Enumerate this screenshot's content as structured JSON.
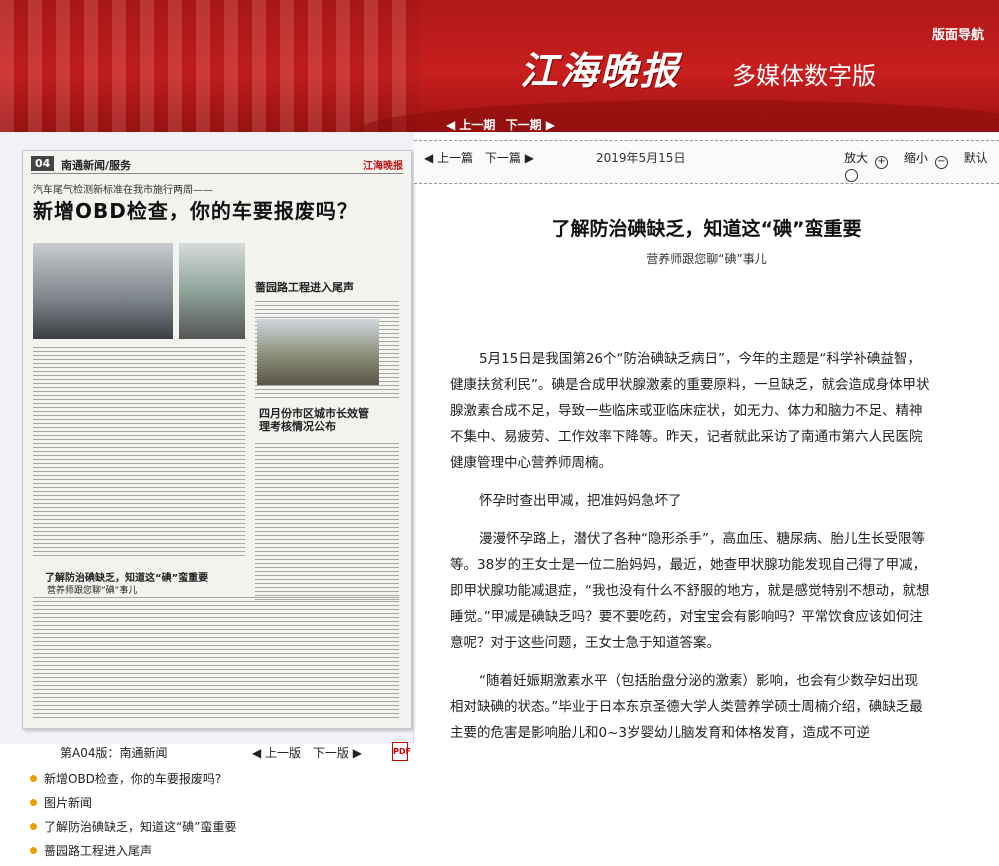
{
  "header": {
    "nav_link": "版面导航",
    "logo_text": "江海晚报",
    "logo_subtitle": "多媒体数字版",
    "prev_issue": "◀ 上一期",
    "next_issue": "下一期 ▶"
  },
  "newspaper": {
    "page_no": "04",
    "section": "南通新闻/服务",
    "brand": "江海晚报",
    "kicker": "汽车尾气检测新标准在我市施行两周——",
    "headline": "新增OBD检查，你的车要报废吗？",
    "sub1": "蔷园路工程进入尾声",
    "sub2": "四月份市区城市长效管理考核情况公布",
    "sub3": "了解防治碘缺乏，知道这“碘”蛮重要",
    "sub3b": "营养师跟您聊“碘”事儿"
  },
  "page_info": {
    "page_label": "第A04版：南通新闻",
    "prev_page": "◀ 上一版",
    "next_page": "下一版 ▶",
    "pdf_icon": "pdf-icon"
  },
  "article_list": [
    "新增OBD检查，你的车要报废吗?",
    "图片新闻",
    "了解防治碘缺乏，知道这“碘”蛮重要",
    "蔷园路工程进入尾声"
  ],
  "toolbar": {
    "prev_article": "◀ 上一篇",
    "next_article": "下一篇 ▶",
    "date": "2019年5月15日",
    "zoom_in": "放大",
    "zoom_out": "缩小",
    "default": "默认"
  },
  "article": {
    "title": "了解防治碘缺乏，知道这“碘”蛮重要",
    "subtitle": "营养师跟您聊“碘”事儿",
    "paragraphs": [
      "5月15日是我国第26个“防治碘缺乏病日”，今年的主题是“科学补碘益智，健康扶贫利民”。碘是合成甲状腺激素的重要原料，一旦缺乏，就会造成身体甲状腺激素合成不足，导致一些临床或亚临床症状，如无力、体力和脑力不足、精神不集中、易疲劳、工作效率下降等。昨天，记者就此采访了南通市第六人民医院健康管理中心营养师周楠。",
      "怀孕时查出甲减，把准妈妈急坏了",
      "漫漫怀孕路上，潜伏了各种“隐形杀手”，高血压、糖尿病、胎儿生长受限等等。38岁的王女士是一位二胎妈妈，最近，她查甲状腺功能发现自己得了甲减，即甲状腺功能减退症，“我也没有什么不舒服的地方，就是感觉特别不想动，就想睡觉。”甲减是碘缺乏吗？要不要吃药，对宝宝会有影响吗？平常饮食应该如何注意呢？对于这些问题，王女士急于知道答案。",
      "“随着妊娠期激素水平（包括胎盘分泌的激素）影响，也会有少数孕妇出现相对缺碘的状态。”毕业于日本东京圣德大学人类营养学硕士周楠介绍，碘缺乏最主要的危害是影响胎儿和0~3岁婴幼儿脑发育和体格发育，造成不可逆"
    ]
  },
  "colors": {
    "banner_red": "#c81e1e",
    "bullet": "#e8a000",
    "pdf_red": "#cc0000"
  }
}
